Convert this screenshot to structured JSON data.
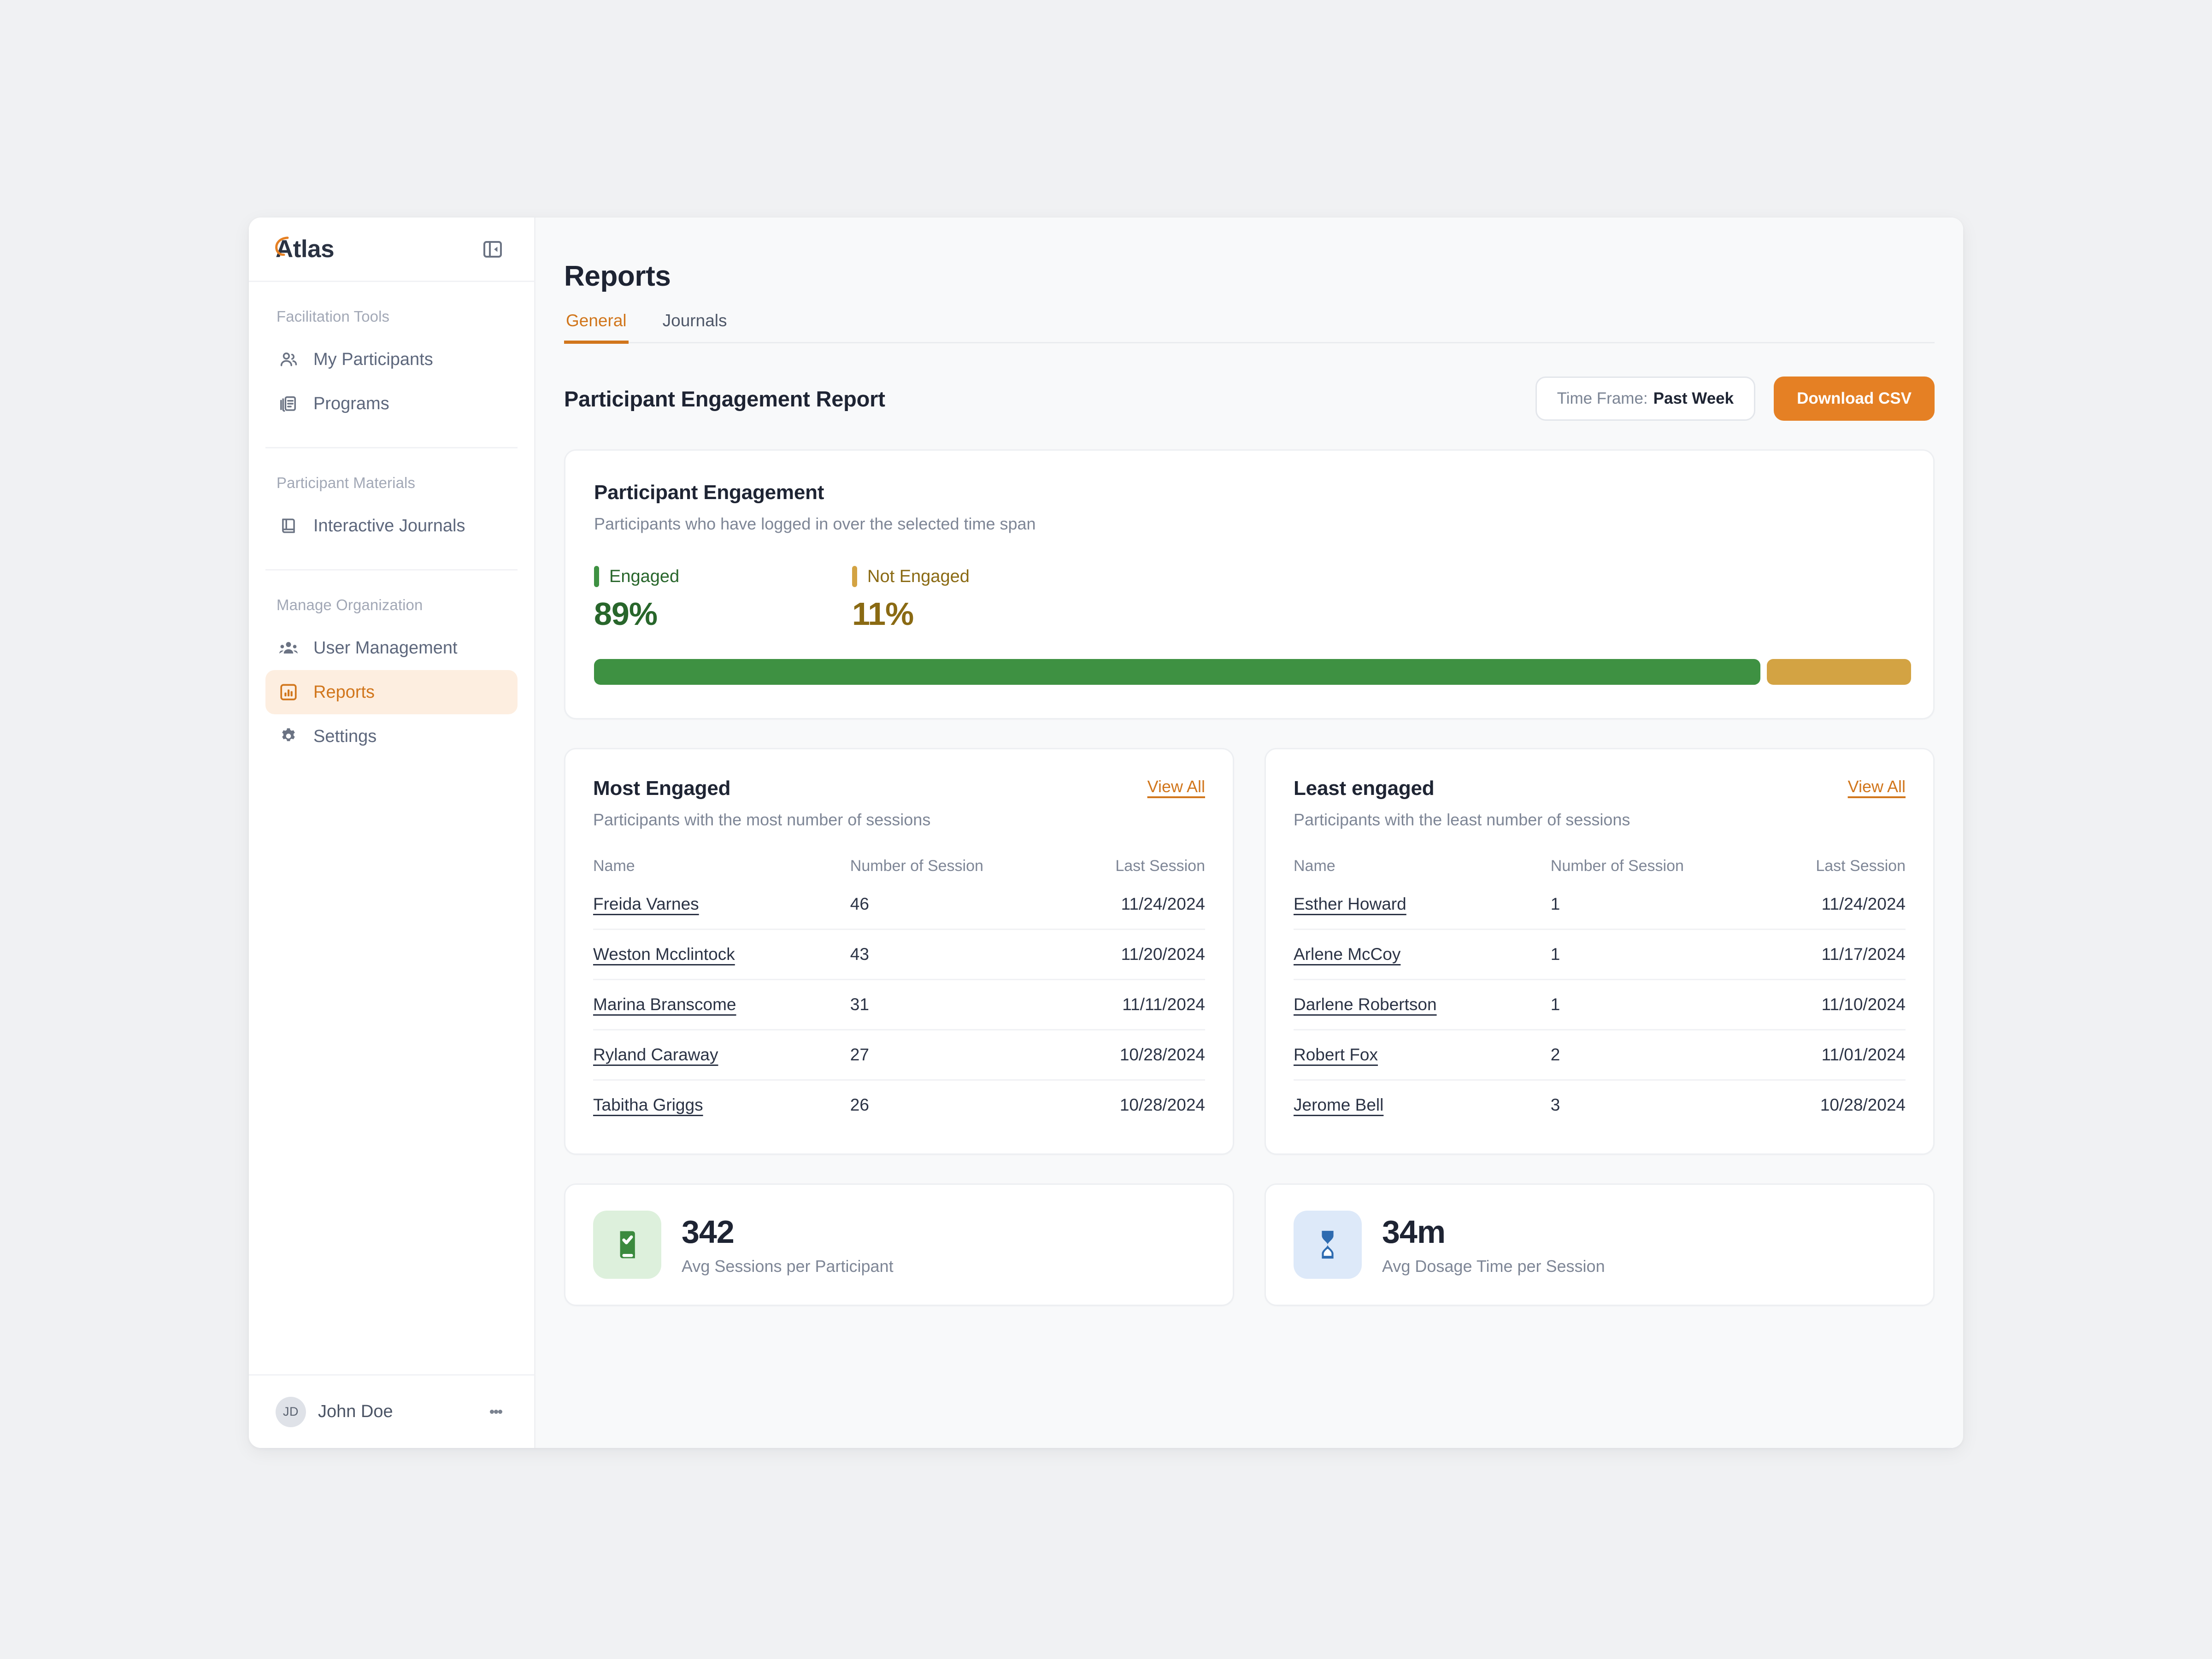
{
  "app": {
    "brand": "Atlas",
    "collapse_icon": "panel-collapse-icon"
  },
  "sidebar": {
    "sections": [
      {
        "label": "Facilitation Tools",
        "items": [
          {
            "label": "My Participants",
            "icon": "users-icon",
            "active": false
          },
          {
            "label": "Programs",
            "icon": "documents-icon",
            "active": false
          }
        ]
      },
      {
        "label": "Participant Materials",
        "items": [
          {
            "label": "Interactive Journals",
            "icon": "book-icon",
            "active": false
          }
        ]
      },
      {
        "label": "Manage Organization",
        "items": [
          {
            "label": "User Management",
            "icon": "user-group-icon",
            "active": false
          },
          {
            "label": "Reports",
            "icon": "bar-chart-icon",
            "active": true
          },
          {
            "label": "Settings",
            "icon": "gear-icon",
            "active": false
          }
        ]
      }
    ],
    "footer": {
      "avatar_initials": "JD",
      "user_name": "John Doe",
      "menu_icon": "kebab-menu-icon"
    }
  },
  "header": {
    "page_title": "Reports",
    "tabs": [
      {
        "label": "General",
        "active": true
      },
      {
        "label": "Journals",
        "active": false
      }
    ]
  },
  "report": {
    "title": "Participant Engagement Report",
    "time_frame_label": "Time Frame:",
    "time_frame_value": "Past Week",
    "download_label": "Download CSV"
  },
  "engagement": {
    "title": "Participant Engagement",
    "subtitle": "Participants who have logged in over the selected time span",
    "engaged_label": "Engaged",
    "engaged_value": "89%",
    "not_engaged_label": "Not Engaged",
    "not_engaged_value": "11%"
  },
  "most_engaged": {
    "title": "Most Engaged",
    "subtitle": "Participants with the most number of sessions",
    "view_all": "View All",
    "columns": {
      "name": "Name",
      "sessions": "Number of Session",
      "last": "Last Session"
    },
    "rows": [
      {
        "name": "Freida Varnes",
        "sessions": "46",
        "last": "11/24/2024"
      },
      {
        "name": "Weston Mcclintock",
        "sessions": "43",
        "last": "11/20/2024"
      },
      {
        "name": "Marina Branscome",
        "sessions": "31",
        "last": "11/11/2024"
      },
      {
        "name": "Ryland Caraway",
        "sessions": "27",
        "last": "10/28/2024"
      },
      {
        "name": "Tabitha Griggs",
        "sessions": "26",
        "last": "10/28/2024"
      }
    ]
  },
  "least_engaged": {
    "title": "Least engaged",
    "subtitle": "Participants with the least number of sessions",
    "view_all": "View All",
    "columns": {
      "name": "Name",
      "sessions": "Number of Session",
      "last": "Last Session"
    },
    "rows": [
      {
        "name": "Esther Howard",
        "sessions": "1",
        "last": "11/24/2024"
      },
      {
        "name": "Arlene McCoy",
        "sessions": "1",
        "last": "11/17/2024"
      },
      {
        "name": "Darlene Robertson",
        "sessions": "1",
        "last": "11/10/2024"
      },
      {
        "name": "Robert Fox",
        "sessions": "2",
        "last": "11/01/2024"
      },
      {
        "name": "Jerome Bell",
        "sessions": "3",
        "last": "10/28/2024"
      }
    ]
  },
  "stats": [
    {
      "value": "342",
      "label": "Avg Sessions per Participant",
      "icon": "journal-check-icon",
      "tone": "green"
    },
    {
      "value": "34m",
      "label": "Avg Dosage Time per Session",
      "icon": "hourglass-icon",
      "tone": "blue"
    }
  ],
  "chart_data": {
    "type": "bar",
    "title": "Participant Engagement",
    "categories": [
      "Engaged",
      "Not Engaged"
    ],
    "values": [
      89,
      11
    ],
    "unit": "%",
    "colors": [
      "#3E9142",
      "#D3A343"
    ],
    "xlabel": "",
    "ylabel": "",
    "ylim": [
      0,
      100
    ],
    "legend": "inline",
    "grid": false
  },
  "colors": {
    "accent": "#E58024",
    "accent_text": "#D1761C",
    "accent_soft_bg": "#FDEEE0",
    "engaged_green": "#3E9142",
    "not_engaged_gold": "#D3A343",
    "page_bg": "#F0F1F3",
    "main_bg": "#F8F9FA",
    "text_dark": "#1E2433",
    "text_muted": "#7E8696"
  }
}
